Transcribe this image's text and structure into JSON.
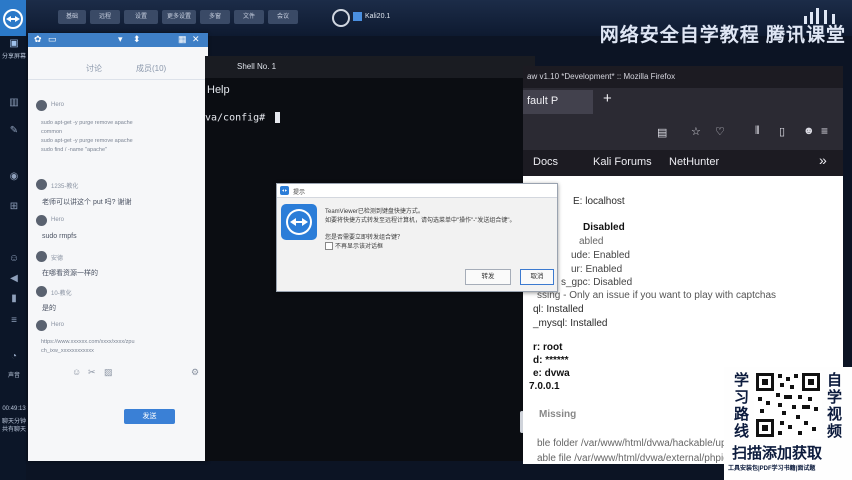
{
  "host": {
    "toolbar_buttons": [
      "基础",
      "远程",
      "设置",
      "更多设置",
      "多窗",
      "文件",
      "会议"
    ],
    "active_vm_label": "Kali20.1",
    "brand_text": "网络安全自学教程 腾讯课堂"
  },
  "dock": {
    "share_label": "分享屏幕",
    "sound_label": "声音",
    "clock_label": "00:49:13",
    "status_label": "聊天分钟 共有聊天"
  },
  "chat": {
    "tabs": [
      "讨论",
      "成员(10)"
    ],
    "messages": [
      {
        "name": "Hero",
        "lines": [
          "sudo apt-get -y purge remove apache",
          "common",
          "sudo apt-get -y purge remove apache",
          "sudo find / -name \"apache\""
        ]
      },
      {
        "name": "1235-教化",
        "lines": [
          "老师可以讲这个 put 吗? 谢谢"
        ]
      },
      {
        "name": "Hero",
        "lines": [
          "sudo rmpfs"
        ]
      },
      {
        "name": "安德",
        "lines": [
          "在哪看资源一样的"
        ]
      },
      {
        "name": "10-教化",
        "lines": [
          "是的"
        ]
      },
      {
        "name": "Hero",
        "lines": [
          "https://www.xxxxxx.com/xxxx/xxxx/zpu",
          "ch_ixw_xxxxxxxxxxxx"
        ]
      }
    ],
    "send_label": "发送"
  },
  "terminal": {
    "title": "Shell No. 1",
    "menu": "Help",
    "prompt": "va/config#"
  },
  "browser": {
    "title": "aw v1.10 *Development* :: Mozilla Firefox",
    "tab_label": "fault P",
    "new_tab": "+",
    "bookmarks": [
      "Docs",
      "Kali Forums",
      "NetHunter"
    ],
    "more_bookmarks": "»",
    "content": {
      "host_line": "E: localhost",
      "setting_1": "Disabled",
      "setting_2": "abled",
      "setting_3": "ude: Enabled",
      "setting_4": "ur: Enabled",
      "setting_5": "s_gpc: Disabled",
      "captcha_line": "ssing - Only an issue if you want to play with captchas",
      "sql_installed": "ql: Installed",
      "mysql_installed": "_mysql: Installed",
      "db_user": "r: root",
      "db_pass": "d: ******",
      "db_name": "e: dvwa",
      "db_host": "7.0.0.1",
      "missing": "Missing",
      "folder_line": "ble folder /var/www/html/dvwa/hackable/up",
      "file_line": "able file /var/www/html/dvwa/external/phpids"
    }
  },
  "dialog": {
    "title": "提示",
    "message_1": "TeamViewer已检测到键盘快捷方式。",
    "message_2": "如要将快捷方式转发至远程计算机，请勾选菜单中\"操作\"-\"发送组合键\"。",
    "question": "您是否需要立即转发组合键？",
    "checkbox_label": "不再显示该对话框",
    "btn_forward": "转发",
    "btn_cancel": "取消"
  },
  "promo": {
    "left_chars": [
      "学",
      "习",
      "路",
      "线"
    ],
    "right_chars": [
      "自",
      "学",
      "视",
      "频"
    ],
    "banner": "扫描添加获取",
    "subline": "工具安装包|PDF学习书籍|面试题"
  },
  "colors": {
    "teamviewer_blue": "#2b7dd8",
    "send_button": "#3a80d6",
    "firefox_dark": "#2b2a33"
  }
}
